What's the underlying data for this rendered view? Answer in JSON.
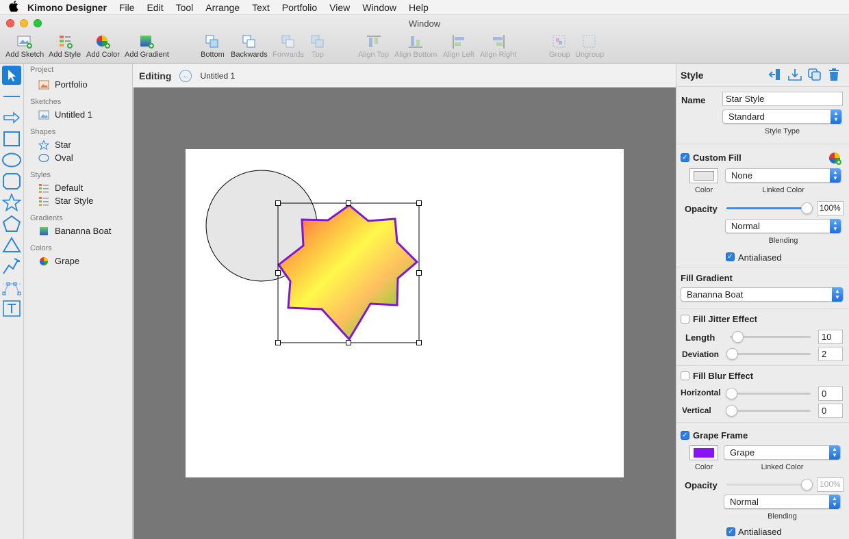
{
  "menubar": {
    "apple": "",
    "app_name": "Kimono Designer",
    "items": [
      "File",
      "Edit",
      "Tool",
      "Arrange",
      "Text",
      "Portfolio",
      "View",
      "Window",
      "Help"
    ]
  },
  "window": {
    "title": "Window"
  },
  "toolbar": {
    "add_sketch": "Add Sketch",
    "add_style": "Add Style",
    "add_color": "Add Color",
    "add_gradient": "Add Gradient",
    "bottom": "Bottom",
    "backwards": "Backwards",
    "forwards": "Forwards",
    "top": "Top",
    "align_top": "Align Top",
    "align_bottom": "Align Bottom",
    "align_left": "Align Left",
    "align_right": "Align Right",
    "group": "Group",
    "ungroup": "Ungroup"
  },
  "tools": [
    "select-tool",
    "line-tool",
    "arrow-tool",
    "rectangle-tool",
    "oval-tool",
    "rounded-rect-tool",
    "star-tool",
    "pentagon-tool",
    "triangle-tool",
    "polyline-tool",
    "bezier-tool",
    "text-tool"
  ],
  "sidebar": {
    "project_label": "Project",
    "project_item": "Portfolio",
    "sketches_label": "Sketches",
    "sketch_item": "Untitled 1",
    "shapes_label": "Shapes",
    "shape_items": [
      "Star",
      "Oval"
    ],
    "styles_label": "Styles",
    "style_items": [
      "Default",
      "Star Style"
    ],
    "gradients_label": "Gradients",
    "gradient_item": "Bananna Boat",
    "colors_label": "Colors",
    "color_item": "Grape"
  },
  "editor": {
    "editing_label": "Editing",
    "document_name": "Untitled 1"
  },
  "inspector": {
    "title": "Style",
    "name_label": "Name",
    "name_value": "Star Style",
    "style_type_value": "Standard",
    "style_type_label": "Style Type",
    "custom_fill": {
      "label": "Custom Fill",
      "color_label": "Color",
      "linked_color_value": "None",
      "linked_color_label": "Linked Color",
      "opacity_label": "Opacity",
      "opacity_value": "100%",
      "opacity_level": 1.0,
      "blending_value": "Normal",
      "blending_label": "Blending",
      "antialiased_label": "Antialiased",
      "swatch_color": "#e6e6e6"
    },
    "fill_gradient": {
      "label": "Fill Gradient",
      "value": "Bananna Boat"
    },
    "fill_jitter": {
      "label": "Fill Jitter Effect",
      "length_label": "Length",
      "length_value": "10",
      "deviation_label": "Deviation",
      "deviation_value": "2"
    },
    "fill_blur": {
      "label": "Fill Blur Effect",
      "horizontal_label": "Horizontal",
      "horizontal_value": "0",
      "vertical_label": "Vertical",
      "vertical_value": "0"
    },
    "grape_frame": {
      "label": "Grape Frame",
      "color_label": "Color",
      "linked_color_value": "Grape",
      "linked_color_label": "Linked Color",
      "opacity_label": "Opacity",
      "opacity_value": "100%",
      "opacity_level": 1.0,
      "blending_value": "Normal",
      "blending_label": "Blending",
      "antialiased_label": "Antialiased",
      "swatch_color": "#8a14f5"
    }
  },
  "colors": {
    "accent": "#1e7fd8",
    "canvas_bg": "#777777",
    "star_stroke": "#7d17d6",
    "oval_fill": "#e6e6e6"
  }
}
